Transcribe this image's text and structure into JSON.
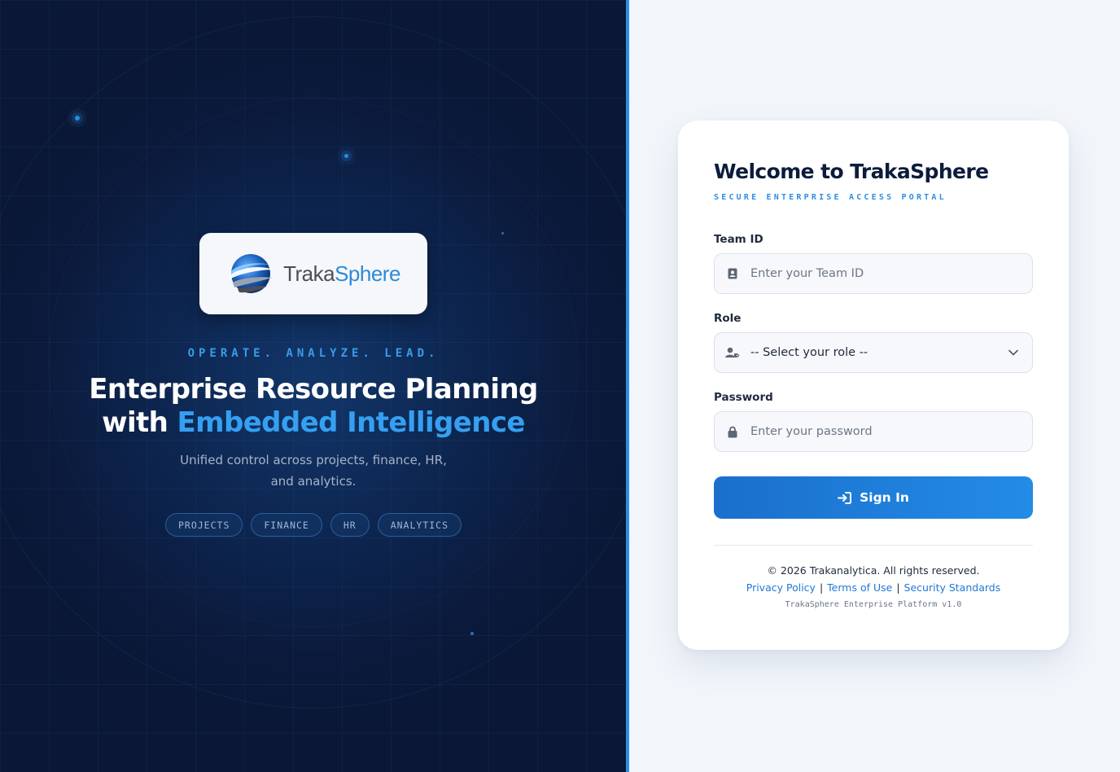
{
  "brand": {
    "name_part1": "Traka",
    "name_part2": "Sphere",
    "colors": {
      "accent": "#2d8fe4",
      "hero_bg": "#0b1a3c",
      "primary_button": "#1f7fd9"
    }
  },
  "hero": {
    "tagline": "OPERATE. ANALYZE. LEAD.",
    "headline_line1": "Enterprise Resource Planning",
    "headline_line2_prefix": "with ",
    "headline_line2_accent": "Embedded Intelligence",
    "subcopy": "Unified control across projects, finance, HR, and analytics.",
    "chips": [
      "PROJECTS",
      "FINANCE",
      "HR",
      "ANALYTICS"
    ]
  },
  "login": {
    "title": "Welcome to TrakaSphere",
    "subtitle": "SECURE ENTERPRISE ACCESS PORTAL",
    "team_id": {
      "label": "Team ID",
      "placeholder": "Enter your Team ID",
      "value": "",
      "icon": "id-card-icon"
    },
    "role": {
      "label": "Role",
      "selected": "-- Select your role --",
      "icon": "user-tag-icon"
    },
    "password": {
      "label": "Password",
      "placeholder": "Enter your password",
      "value": "",
      "icon": "lock-icon"
    },
    "submit_label": "Sign In",
    "footer": {
      "copyright": "© 2026 Trakanalytica. All rights reserved.",
      "links": [
        "Privacy Policy",
        "Terms of Use",
        "Security Standards"
      ],
      "version": "TrakaSphere Enterprise Platform v1.0"
    }
  }
}
